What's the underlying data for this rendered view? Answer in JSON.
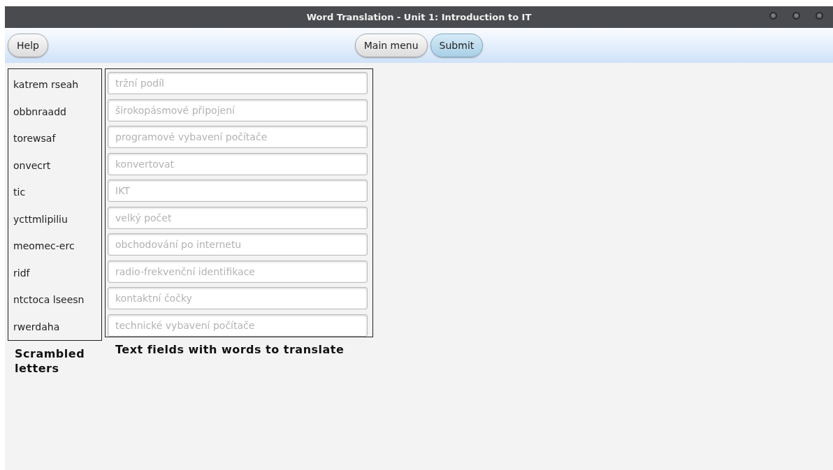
{
  "window": {
    "title": "Word Translation - Unit 1: Introduction to IT"
  },
  "toolbar": {
    "left_buttons": [
      {
        "label": "Help",
        "default": false
      }
    ],
    "center_buttons": [
      {
        "label": "Main menu",
        "default": false
      },
      {
        "label": "Submit",
        "default": true
      }
    ]
  },
  "rows": [
    {
      "scrambled": "katrem rseah",
      "placeholder": "tržní podíl"
    },
    {
      "scrambled": "obbnraadd",
      "placeholder": "širokopásmové připojení"
    },
    {
      "scrambled": "torewsaf",
      "placeholder": "programové vybavení počítače"
    },
    {
      "scrambled": "onvecrt",
      "placeholder": "konvertovat"
    },
    {
      "scrambled": "tic",
      "placeholder": "IKT"
    },
    {
      "scrambled": "ycttmlipiliu",
      "placeholder": "velký počet"
    },
    {
      "scrambled": "meomec-erc",
      "placeholder": "obchodování po internetu"
    },
    {
      "scrambled": "ridf",
      "placeholder": "radio-frekvenční identifikace"
    },
    {
      "scrambled": "ntctoca lseesn",
      "placeholder": "kontaktní čočky"
    },
    {
      "scrambled": "rwerdaha",
      "placeholder": "technické vybavení počítače"
    }
  ],
  "captions": {
    "scrambled": "Scrambled letters",
    "fields": "Text fields with words to translate"
  }
}
